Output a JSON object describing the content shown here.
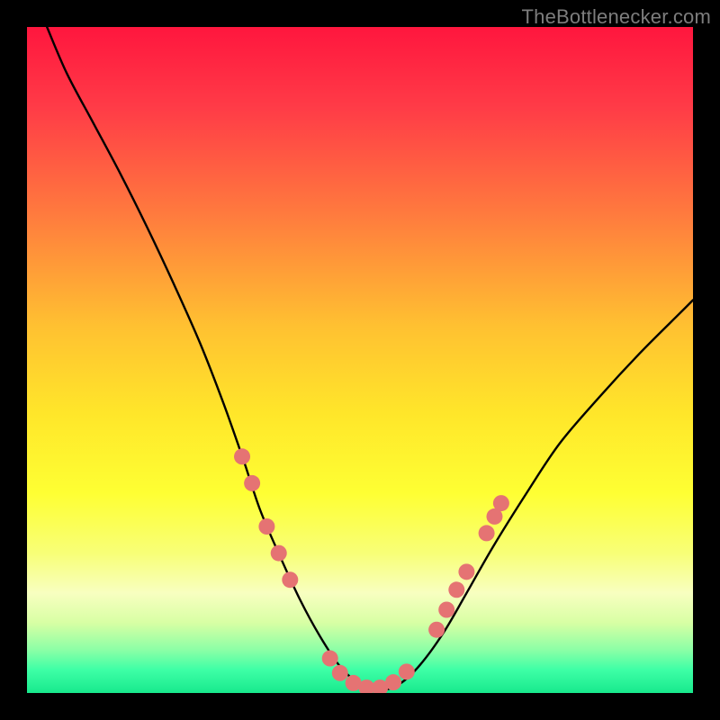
{
  "watermark": "TheBottlenecker.com",
  "chart_data": {
    "type": "line",
    "title": "",
    "xlabel": "",
    "ylabel": "",
    "xlim": [
      0,
      100
    ],
    "ylim": [
      0,
      100
    ],
    "gradient_stops": [
      {
        "offset": 0,
        "color": "#ff163e"
      },
      {
        "offset": 0.12,
        "color": "#ff3b47"
      },
      {
        "offset": 0.28,
        "color": "#ff7a3e"
      },
      {
        "offset": 0.45,
        "color": "#ffc131"
      },
      {
        "offset": 0.58,
        "color": "#ffe62a"
      },
      {
        "offset": 0.7,
        "color": "#feff33"
      },
      {
        "offset": 0.79,
        "color": "#f8ff77"
      },
      {
        "offset": 0.85,
        "color": "#f8ffc0"
      },
      {
        "offset": 0.895,
        "color": "#d7ffa4"
      },
      {
        "offset": 0.935,
        "color": "#8cffa6"
      },
      {
        "offset": 0.965,
        "color": "#3effa6"
      },
      {
        "offset": 1.0,
        "color": "#18e98d"
      }
    ],
    "series": [
      {
        "name": "bottleneck-curve",
        "x": [
          3,
          6,
          10,
          14,
          18,
          22,
          26,
          29.5,
          32.5,
          35,
          38,
          41,
          44,
          47,
          50,
          53,
          56,
          59,
          62.5,
          66,
          70,
          75,
          80,
          86,
          92,
          98,
          100
        ],
        "y": [
          100,
          93,
          85.5,
          78,
          70,
          61.5,
          52.5,
          43.5,
          35,
          27.5,
          20.5,
          14,
          8.5,
          4,
          1.3,
          0.4,
          1.4,
          4.2,
          9,
          15,
          22,
          30,
          37.5,
          44.5,
          51,
          57,
          59
        ]
      }
    ],
    "markers": {
      "name": "highlight-dots",
      "color": "#e57373",
      "radius": 9,
      "points": [
        {
          "x": 32.3,
          "y": 35.5
        },
        {
          "x": 33.8,
          "y": 31.5
        },
        {
          "x": 36.0,
          "y": 25.0
        },
        {
          "x": 37.8,
          "y": 21.0
        },
        {
          "x": 39.5,
          "y": 17.0
        },
        {
          "x": 45.5,
          "y": 5.2
        },
        {
          "x": 47.0,
          "y": 3.0
        },
        {
          "x": 49.0,
          "y": 1.5
        },
        {
          "x": 51.0,
          "y": 0.8
        },
        {
          "x": 53.0,
          "y": 0.8
        },
        {
          "x": 55.0,
          "y": 1.6
        },
        {
          "x": 57.0,
          "y": 3.2
        },
        {
          "x": 61.5,
          "y": 9.5
        },
        {
          "x": 63.0,
          "y": 12.5
        },
        {
          "x": 64.5,
          "y": 15.5
        },
        {
          "x": 66.0,
          "y": 18.2
        },
        {
          "x": 69.0,
          "y": 24.0
        },
        {
          "x": 70.2,
          "y": 26.5
        },
        {
          "x": 71.2,
          "y": 28.5
        }
      ]
    }
  }
}
